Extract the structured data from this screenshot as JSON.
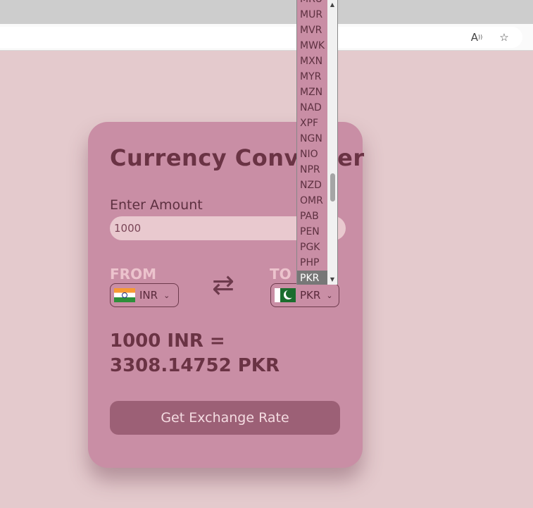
{
  "browser": {
    "read_aloud_icon": "read-aloud-icon",
    "favorite_icon": "star-icon"
  },
  "converter": {
    "title": "Currency Converter",
    "amount_label": "Enter Amount",
    "amount_value": "1000",
    "from_label": "FROM",
    "to_label": "TO",
    "from_currency": "INR",
    "to_currency": "PKR",
    "swap_icon": "swap-arrows-icon",
    "result": "1000 INR = 3308.14752 PKR",
    "button_label": "Get Exchange Rate"
  },
  "dropdown": {
    "items": [
      "MRU",
      "MUR",
      "MVR",
      "MWK",
      "MXN",
      "MYR",
      "MZN",
      "NAD",
      "XPF",
      "NGN",
      "NIO",
      "NPR",
      "NZD",
      "OMR",
      "PAB",
      "PEN",
      "PGK",
      "PHP",
      "PKR"
    ],
    "selected": "PKR"
  },
  "colors": {
    "background": "#e4cacd",
    "card": "#c98ea5",
    "button": "#9c6076",
    "title_text": "#6a3344"
  }
}
